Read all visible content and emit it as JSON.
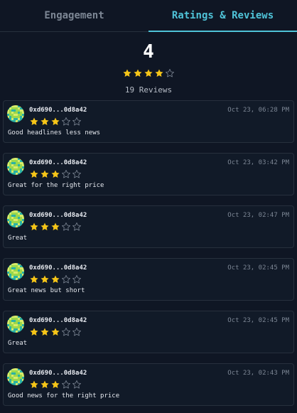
{
  "tabs": [
    {
      "label": "Engagement",
      "active": false
    },
    {
      "label": "Ratings & Reviews",
      "active": true
    }
  ],
  "summary": {
    "average": "4",
    "rating": 4,
    "max_rating": 5,
    "count_text": "19 Reviews"
  },
  "colors": {
    "accent": "#4fc3d8",
    "star_filled": "#f5c518",
    "star_empty": "#7c8694",
    "background": "#0f1624",
    "card": "#111a28"
  },
  "reviews": [
    {
      "address": "0xd690...0d8a42",
      "date": "Oct 23, 06:28 PM",
      "rating": 3,
      "text": "Good headlines less news"
    },
    {
      "address": "0xd690...0d8a42",
      "date": "Oct 23, 03:42 PM",
      "rating": 3,
      "text": "Great for the right price"
    },
    {
      "address": "0xd690...0d8a42",
      "date": "Oct 23, 02:47 PM",
      "rating": 3,
      "text": "Great"
    },
    {
      "address": "0xd690...0d8a42",
      "date": "Oct 23, 02:45 PM",
      "rating": 3,
      "text": "Great news but short"
    },
    {
      "address": "0xd690...0d8a42",
      "date": "Oct 23, 02:45 PM",
      "rating": 3,
      "text": "Great"
    },
    {
      "address": "0xd690...0d8a42",
      "date": "Oct 23, 02:43 PM",
      "rating": 3,
      "text": "Good news for the right price"
    }
  ]
}
